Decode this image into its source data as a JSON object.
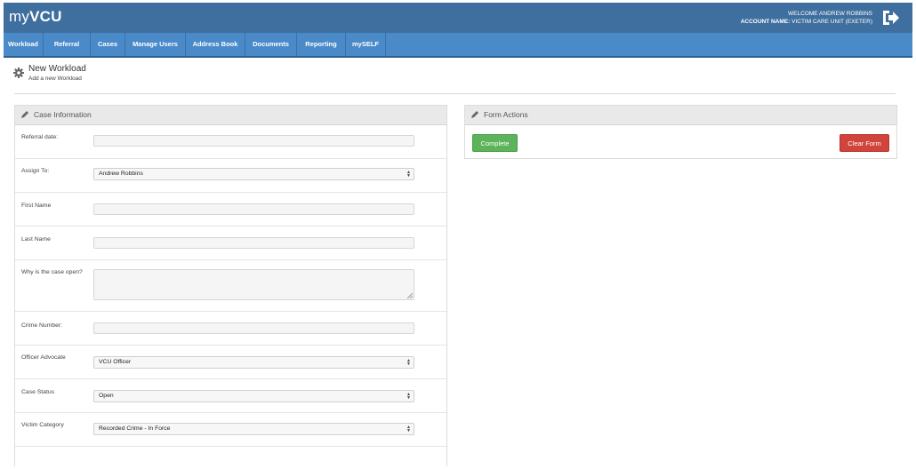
{
  "app": {
    "logo_prefix": "my",
    "logo_bold": "VCU"
  },
  "header": {
    "welcome_text": "WELCOME ANDREW ROBBINS",
    "account_label": "ACCOUNT NAME:",
    "account_value": "VICTIM CARE UNIT (EXETER)",
    "logout_icon": "logout-icon"
  },
  "nav": {
    "items": [
      {
        "label": "Workload"
      },
      {
        "label": "Referral"
      },
      {
        "label": "Cases"
      },
      {
        "label": "Manage Users"
      },
      {
        "label": "Address Book"
      },
      {
        "label": "Documents"
      },
      {
        "label": "Reporting"
      },
      {
        "label": "mySELF"
      }
    ]
  },
  "page": {
    "title": "New Workload",
    "subtitle": "Add a new Workload",
    "icon": "gear-icon"
  },
  "case_info": {
    "title": "Case Information",
    "fields": {
      "referral_date": {
        "label": "Referral date:",
        "value": ""
      },
      "assign_to": {
        "label": "Assign To:",
        "value": "Andrew Robbins"
      },
      "first_name": {
        "label": "First Name",
        "value": ""
      },
      "last_name": {
        "label": "Last Name",
        "value": ""
      },
      "why_open": {
        "label": "Why is the case open?",
        "value": ""
      },
      "crime_number": {
        "label": "Crime Number:",
        "value": ""
      },
      "officer_advocate": {
        "label": "Officer Advocate",
        "value": "VCU Officer"
      },
      "case_status": {
        "label": "Case Status",
        "value": "Open"
      },
      "victim_category": {
        "label": "Victim Category",
        "value": "Recorded Crime - In Force"
      }
    }
  },
  "form_actions": {
    "title": "Form Actions",
    "complete_label": "Complete",
    "clear_label": "Clear Form"
  },
  "colors": {
    "topbar": "#3f6f9f",
    "navbar": "#4a8ac9",
    "complete": "#5cb35a",
    "clear": "#d0443b"
  }
}
